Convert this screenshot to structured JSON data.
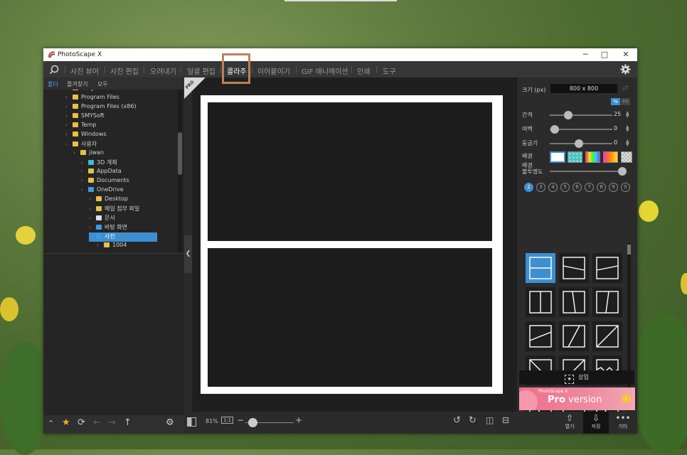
{
  "window": {
    "title": "PhotoScape X"
  },
  "menu": {
    "items": [
      "사진 뷰어",
      "사진 편집",
      "오려내기",
      "일괄 편집",
      "콜라주",
      "이어붙이기",
      "GIF 애니메이션",
      "인쇄",
      "도구"
    ],
    "active": "콜라주"
  },
  "left_panel": {
    "tabs": [
      "폴더",
      "즐겨찾기",
      "모두"
    ],
    "tree": [
      {
        "label": "ProgramData",
        "depth": 0
      },
      {
        "label": "Program Files",
        "depth": 0
      },
      {
        "label": "Program Files (x86)",
        "depth": 0
      },
      {
        "label": "SMYSoft",
        "depth": 0
      },
      {
        "label": "Temp",
        "depth": 0
      },
      {
        "label": "Windows",
        "depth": 0
      },
      {
        "label": "사용자",
        "depth": 0
      },
      {
        "label": "jiwan",
        "depth": 1
      },
      {
        "label": "3D 개체",
        "depth": 2
      },
      {
        "label": "AppData",
        "depth": 2
      },
      {
        "label": "Documents",
        "depth": 2
      },
      {
        "label": "OneDrive",
        "depth": 2
      },
      {
        "label": "Desktop",
        "depth": 3
      },
      {
        "label": "메일 첨부 파일",
        "depth": 3
      },
      {
        "label": "문서",
        "depth": 3
      },
      {
        "label": "바탕 화면",
        "depth": 3
      },
      {
        "label": "사진",
        "depth": 3,
        "selected": true
      },
      {
        "label": "1004",
        "depth": 4
      }
    ]
  },
  "canvas": {
    "badge": "PRO",
    "zoom": "81%",
    "ratio": "1:1"
  },
  "right_panel": {
    "size_label": "크기 (px)",
    "size_value": "800 x 800",
    "unit_percent": "%",
    "unit_px": "PX",
    "spacing": {
      "label": "간격",
      "value": "25"
    },
    "margin": {
      "label": "여백",
      "value": "0"
    },
    "roundness": {
      "label": "둥글기",
      "value": "0"
    },
    "background_label": "배경",
    "bg_opacity_label_1": "배경",
    "bg_opacity_label_2": "불투명도",
    "counts": [
      "2",
      "3",
      "4",
      "5",
      "6",
      "7",
      "8",
      "9",
      "0"
    ],
    "active_count": "2",
    "insert_label": "삽입",
    "pro_banner": {
      "small": "PhotoScape X",
      "big_a": "Pro",
      "big_b": " version"
    },
    "bottom": [
      "열기",
      "저장",
      "기타"
    ]
  },
  "colors": {
    "accent": "#3d8fd0",
    "highlight_box": "#c0805a",
    "window_bg": "#2b2b2b"
  }
}
